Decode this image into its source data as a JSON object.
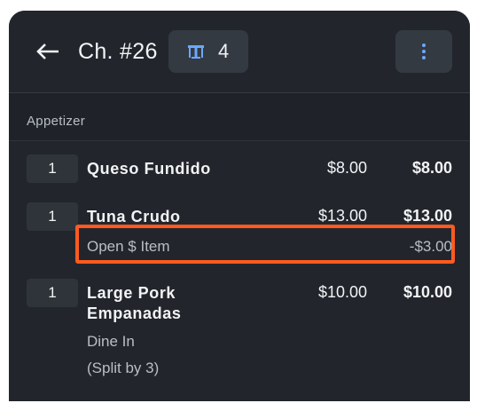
{
  "header": {
    "back_icon": "arrow-left-icon",
    "title": "Ch. #26",
    "table_icon": "table-icon",
    "table_count": "4",
    "more_icon": "more-vertical-icon",
    "accent_color": "#6aa8ff"
  },
  "section": {
    "label": "Appetizer"
  },
  "items": [
    {
      "qty": "1",
      "name": "Queso Fundido",
      "unit_price": "$8.00",
      "total": "$8.00"
    },
    {
      "qty": "1",
      "name": "Tuna Crudo",
      "unit_price": "$13.00",
      "total": "$13.00",
      "modifier": {
        "label": "Open $ Item",
        "price": "-$3.00",
        "highlighted": true,
        "highlight_color": "#ff5a1f"
      }
    },
    {
      "qty": "1",
      "name_line1": "Large Pork",
      "name_line2": "Empanadas",
      "unit_price": "$10.00",
      "total": "$10.00",
      "notes": [
        "Dine In",
        "(Split by 3)"
      ]
    }
  ]
}
